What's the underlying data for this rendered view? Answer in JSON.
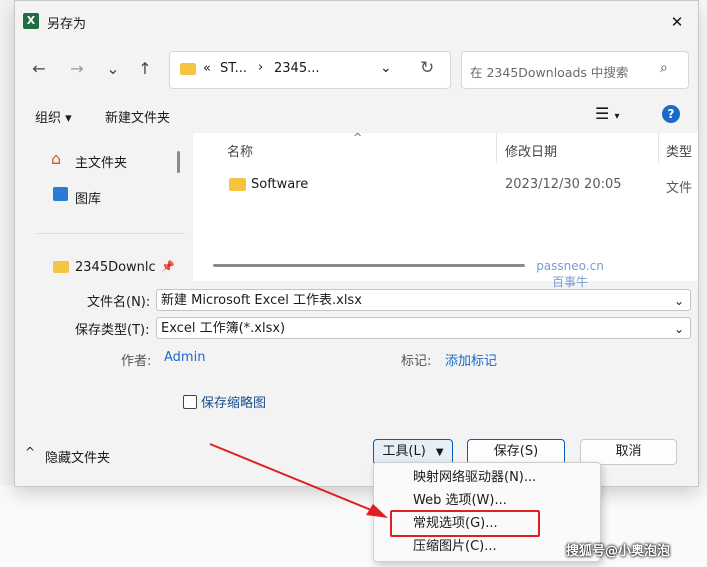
{
  "title": "另存为",
  "close": "✕",
  "nav": {
    "back": "←",
    "forward": "→",
    "down": "⌄",
    "up": "↑",
    "crumbs": [
      "«",
      "ST...",
      "›",
      "2345..."
    ],
    "search_placeholder": "在 2345Downloads 中搜索"
  },
  "toolbar": {
    "organize": "组织 ▾",
    "new_folder": "新建文件夹"
  },
  "sidebar": {
    "items": [
      {
        "label": "主文件夹"
      },
      {
        "label": "图库"
      },
      {
        "label": "2345Downlc"
      }
    ]
  },
  "columns": {
    "name": "名称",
    "date": "修改日期",
    "type": "类型"
  },
  "files": [
    {
      "name": "Software",
      "date": "2023/12/30 20:05",
      "type": "文件夹"
    }
  ],
  "form": {
    "filename_label": "文件名(N):",
    "filename_value": "新建 Microsoft Excel 工作表.xlsx",
    "filetype_label": "保存类型(T):",
    "filetype_value": "Excel 工作簿(*.xlsx)",
    "author_label": "作者:",
    "author_value": "Admin",
    "tags_label": "标记:",
    "tags_value": "添加标记",
    "thumbnail_label": "保存缩略图"
  },
  "footer": {
    "hide_folders": "隐藏文件夹",
    "tools": "工具(L)",
    "save": "保存(S)",
    "cancel": "取消"
  },
  "menu": {
    "items": [
      {
        "label": "映射网络驱动器(N)..."
      },
      {
        "label": "Web 选项(W)..."
      },
      {
        "label": "常规选项(G)..."
      },
      {
        "label": "压缩图片(C)..."
      }
    ]
  },
  "watermark": {
    "line1": "passneo.cn",
    "line2": "百事牛",
    "corner": "搜狐号@小奥泡泡"
  },
  "colors": {
    "accent": "#005fb8",
    "highlight": "#e02020",
    "folder": "#f4c542"
  }
}
